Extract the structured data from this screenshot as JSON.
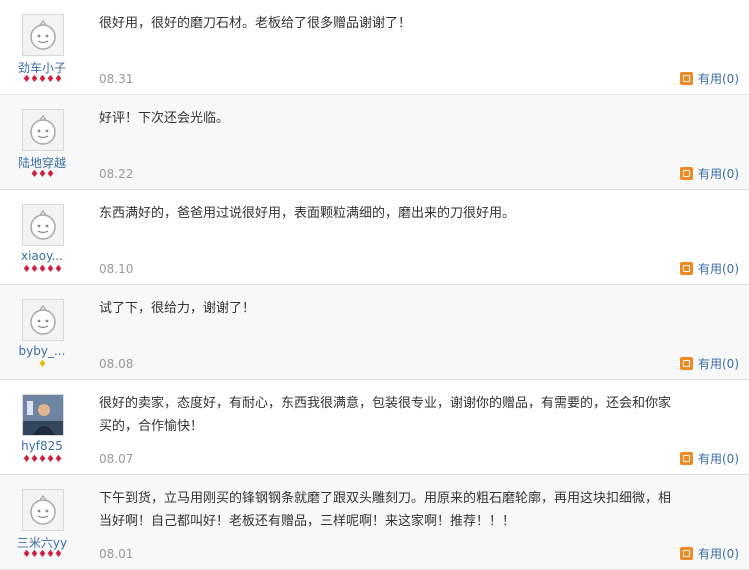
{
  "reviews": [
    {
      "user": "劲车小子",
      "rank": "♦♦♦♦♦",
      "rank_type": "red",
      "avatar": "default-avatar",
      "comment": "很好用，很好的磨刀石材。老板给了很多赠品谢谢了！",
      "date": "08.31",
      "useful_label": "有用(0)"
    },
    {
      "user": "陆地穿越",
      "rank": "♦♦♦",
      "rank_type": "red",
      "avatar": "default-avatar",
      "comment": "好评！下次还会光临。",
      "date": "08.22",
      "useful_label": "有用(0)"
    },
    {
      "user": "xiaoy...",
      "rank": "♦♦♦♦♦",
      "rank_type": "red",
      "avatar": "default-avatar",
      "comment": "东西满好的，爸爸用过说很好用，表面颗粒满细的，磨出来的刀很好用。",
      "date": "08.10",
      "useful_label": "有用(0)"
    },
    {
      "user": "byby_...",
      "rank": "♦",
      "rank_type": "gold",
      "avatar": "default-avatar",
      "comment": "试了下，很给力，谢谢了！",
      "date": "08.08",
      "useful_label": "有用(0)"
    },
    {
      "user": "hyf825",
      "rank": "♦♦♦♦♦",
      "rank_type": "red",
      "avatar": "photo-avatar",
      "comment": "很好的卖家，态度好，有耐心，东西我很满意，包装很专业，谢谢你的赠品，有需要的，还会和你家买的，合作愉快！",
      "date": "08.07",
      "useful_label": "有用(0)"
    },
    {
      "user": "三米六yy",
      "rank": "♦♦♦♦♦",
      "rank_type": "red",
      "avatar": "default-avatar",
      "comment": "下午到货，立马用刚买的锋钢钢条就磨了跟双头雕刻刀。用原来的粗石磨轮廓，再用这块扣细微，相当好啊！自己都叫好！老板还有赠品，三样呢啊！来这家啊！推荐！！！",
      "date": "08.01",
      "useful_label": "有用(0)"
    }
  ]
}
